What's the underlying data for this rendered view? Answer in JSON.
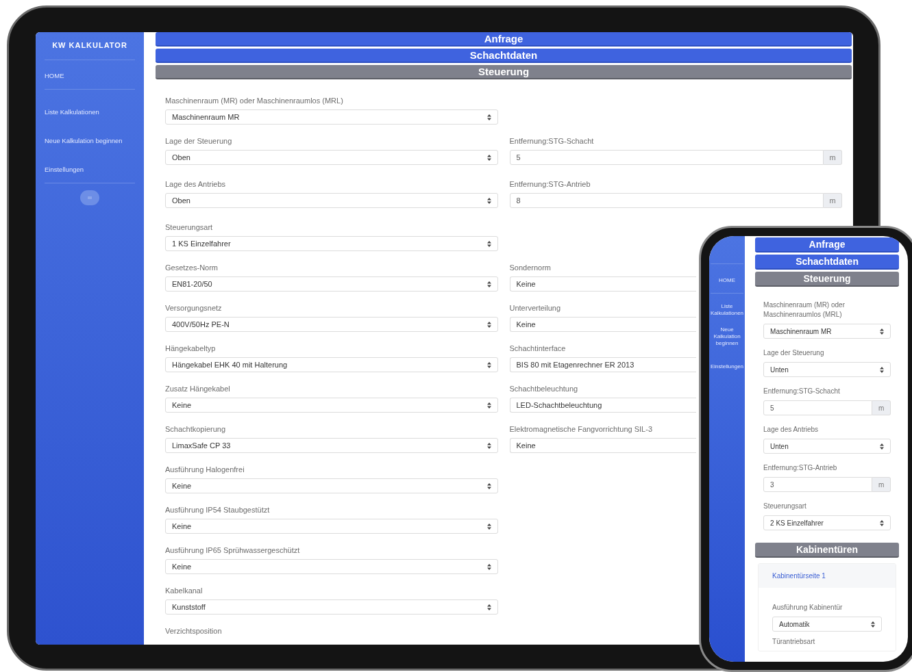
{
  "tablet": {
    "sidebar": {
      "brand": "KW KALKULATOR",
      "items": [
        {
          "label": "HOME"
        },
        {
          "label": "Liste Kalkulationen"
        },
        {
          "label": "Neue Kalkulation beginnen"
        },
        {
          "label": "Einstellungen"
        }
      ]
    },
    "sections": [
      {
        "title": "Anfrage",
        "selected": false
      },
      {
        "title": "Schachtdaten",
        "selected": false
      },
      {
        "title": "Steuerung",
        "selected": true
      }
    ],
    "rows": [
      {
        "left": {
          "label": "Maschinenraum (MR) oder Maschinenraumlos (MRL)",
          "kind": "select",
          "value": "Maschinenraum MR"
        }
      },
      {
        "left": {
          "label": "Lage der Steuerung",
          "kind": "select",
          "value": "Oben"
        },
        "right": {
          "label": "Entfernung:STG-Schacht",
          "kind": "number",
          "value": "5",
          "unit": "m"
        }
      },
      {
        "left": {
          "label": "Lage des Antriebs",
          "kind": "select",
          "value": "Oben"
        },
        "right": {
          "label": "Entfernung:STG-Antrieb",
          "kind": "number",
          "value": "8",
          "unit": "m"
        }
      },
      {
        "left": {
          "label": "Steuerungsart",
          "kind": "select",
          "value": "1 KS Einzelfahrer"
        }
      },
      {
        "left": {
          "label": "Gesetzes-Norm",
          "kind": "select",
          "value": "EN81-20/50"
        },
        "right": {
          "label": "Sondernorm",
          "kind": "select",
          "value": "Keine"
        }
      },
      {
        "left": {
          "label": "Versorgungsnetz",
          "kind": "select",
          "value": "400V/50Hz PE-N"
        },
        "right": {
          "label": "Unterverteilung",
          "kind": "select",
          "value": "Keine"
        }
      },
      {
        "left": {
          "label": "Hängekabeltyp",
          "kind": "select",
          "value": "Hängekabel EHK 40 mit Halterung"
        },
        "right": {
          "label": "Schachtinterface",
          "kind": "select",
          "value": "BIS 80 mit Etagenrechner ER 2013"
        }
      },
      {
        "left": {
          "label": "Zusatz Hängekabel",
          "kind": "select",
          "value": "Keine"
        },
        "right": {
          "label": "Schachtbeleuchtung",
          "kind": "select",
          "value": "LED-Schachtbeleuchtung"
        }
      },
      {
        "left": {
          "label": "Schachtkopierung",
          "kind": "select",
          "value": "LimaxSafe CP 33"
        },
        "right": {
          "label": "Elektromagnetische Fangvorrichtung SIL-3",
          "kind": "select",
          "value": "Keine"
        }
      },
      {
        "left": {
          "label": "Ausführung Halogenfrei",
          "kind": "select",
          "value": "Keine"
        }
      },
      {
        "left": {
          "label": "Ausführung IP54 Staubgestützt",
          "kind": "select",
          "value": "Keine"
        }
      },
      {
        "left": {
          "label": "Ausführung IP65 Sprühwassergeschützt",
          "kind": "select",
          "value": "Keine"
        }
      },
      {
        "left": {
          "label": "Kabelkanal",
          "kind": "select",
          "value": "Kunststoff"
        }
      },
      {
        "left": {
          "label": "Verzichtsposition",
          "kind": "label"
        }
      }
    ]
  },
  "phone": {
    "sidebar": {
      "items": [
        {
          "label": "HOME"
        },
        {
          "label": "Liste Kalkulationen"
        },
        {
          "label": "Neue Kalkulation beginnen"
        },
        {
          "label": "Einstellungen"
        }
      ]
    },
    "sections": [
      {
        "title": "Anfrage",
        "selected": false
      },
      {
        "title": "Schachtdaten",
        "selected": false
      },
      {
        "title": "Steuerung",
        "selected": true
      }
    ],
    "fields": [
      {
        "label": "Maschinenraum (MR) oder Maschinenraumlos (MRL)",
        "kind": "select",
        "value": "Maschinenraum MR"
      },
      {
        "label": "Lage der Steuerung",
        "kind": "select",
        "value": "Unten"
      },
      {
        "label": "Entfernung:STG-Schacht",
        "kind": "number",
        "value": "5",
        "unit": "m"
      },
      {
        "label": "Lage des Antriebs",
        "kind": "select",
        "value": "Unten"
      },
      {
        "label": "Entfernung:STG-Antrieb",
        "kind": "number",
        "value": "3",
        "unit": "m"
      },
      {
        "label": "Steuerungsart",
        "kind": "select",
        "value": "2 KS Einzelfahrer"
      }
    ],
    "doors": {
      "title": "Kabinentüren",
      "selected": true,
      "tabs": [
        {
          "label": "Kabinentürseite 1",
          "selected": true
        }
      ],
      "fields": [
        {
          "label": "Ausführung Kabinentür",
          "kind": "select",
          "value": "Automatik"
        },
        {
          "label": "Türantriebsart",
          "kind": "label"
        }
      ]
    }
  }
}
